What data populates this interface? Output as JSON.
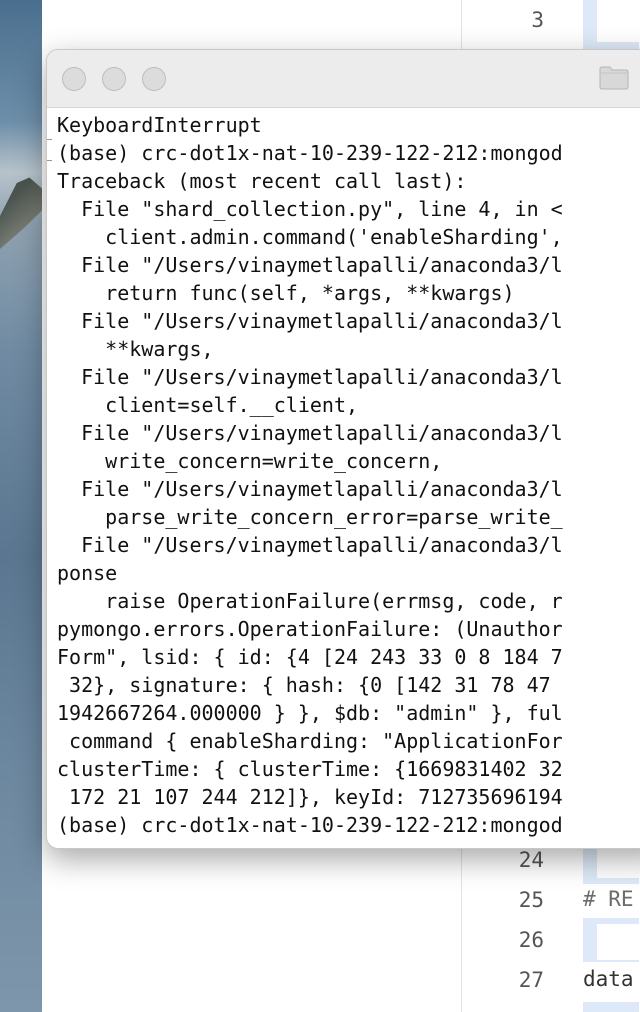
{
  "editor": {
    "line_numbers": [
      "3",
      "24",
      "25",
      "26",
      "27"
    ],
    "code_lines": [
      "# RE",
      "data"
    ]
  },
  "terminal": {
    "lines": [
      "KeyboardInterrupt",
      "(base) crc-dot1x-nat-10-239-122-212:mongod",
      "Traceback (most recent call last):",
      "  File \"shard_collection.py\", line 4, in <",
      "    client.admin.command('enableSharding',",
      "  File \"/Users/vinaymetlapalli/anaconda3/l",
      "    return func(self, *args, **kwargs)",
      "  File \"/Users/vinaymetlapalli/anaconda3/l",
      "    **kwargs,",
      "  File \"/Users/vinaymetlapalli/anaconda3/l",
      "    client=self.__client,",
      "  File \"/Users/vinaymetlapalli/anaconda3/l",
      "    write_concern=write_concern,",
      "  File \"/Users/vinaymetlapalli/anaconda3/l",
      "    parse_write_concern_error=parse_write_",
      "  File \"/Users/vinaymetlapalli/anaconda3/l",
      "ponse",
      "    raise OperationFailure(errmsg, code, r",
      "pymongo.errors.OperationFailure: (Unauthor",
      "Form\", lsid: { id: {4 [24 243 33 0 8 184 7",
      " 32}, signature: { hash: {0 [142 31 78 47 ",
      "1942667264.000000 } }, $db: \"admin\" }, ful",
      " command { enableSharding: \"ApplicationFor",
      "clusterTime: { clusterTime: {1669831402 32",
      " 172 21 107 244 212]}, keyId: 712735696194",
      "(base) crc-dot1x-nat-10-239-122-212:mongod"
    ]
  }
}
